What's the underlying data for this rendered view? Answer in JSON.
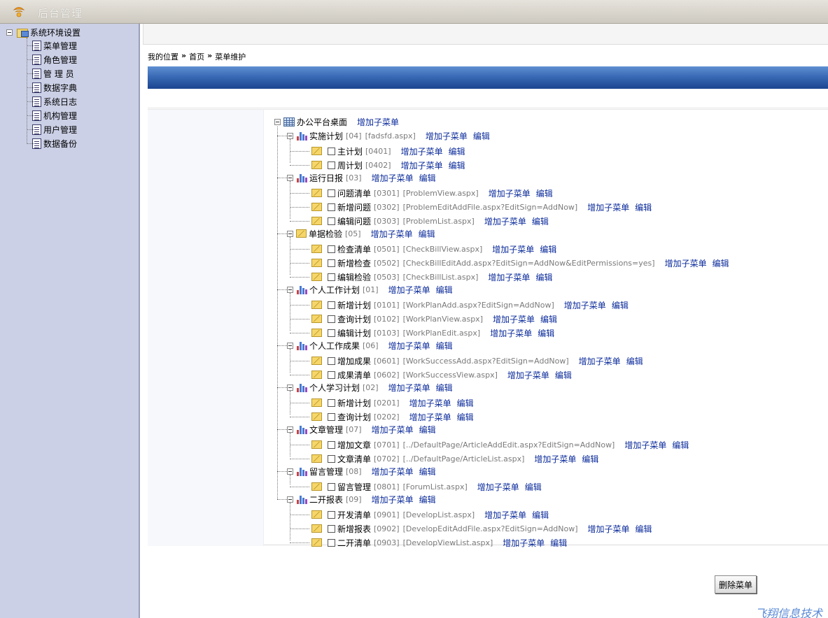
{
  "app": {
    "title": "后台管理"
  },
  "sidebar": {
    "root_label": "系统环境设置",
    "items": [
      {
        "label": "菜单管理"
      },
      {
        "label": "角色管理"
      },
      {
        "label": "管 理 员"
      },
      {
        "label": "数据字典"
      },
      {
        "label": "系统日志"
      },
      {
        "label": "机构管理"
      },
      {
        "label": "用户管理"
      },
      {
        "label": "数据备份"
      }
    ]
  },
  "breadcrumb": {
    "prefix": "我的位置",
    "sep": "»",
    "home": "首页",
    "current": "菜单维护"
  },
  "menu_tree": {
    "root": {
      "label": "办公平台桌面",
      "add": "增加子菜单"
    },
    "groups": [
      {
        "label": "实施计划",
        "code": "[04]",
        "url": "[fadsfd.aspx]",
        "add": "增加子菜单",
        "edit": "编辑",
        "icon": "bars-icon",
        "children": [
          {
            "label": "主计划",
            "code": "[0401]",
            "url": "",
            "add": "增加子菜单",
            "edit": "编辑"
          },
          {
            "label": "周计划",
            "code": "[0402]",
            "url": "",
            "add": "增加子菜单",
            "edit": "编辑"
          }
        ]
      },
      {
        "label": "运行日报",
        "code": "[03]",
        "url": "",
        "add": "增加子菜单",
        "edit": "编辑",
        "icon": "bars-icon",
        "children": [
          {
            "label": "问题清单",
            "code": "[0301]",
            "url": "[ProblemView.aspx]",
            "add": "增加子菜单",
            "edit": "编辑"
          },
          {
            "label": "新增问题",
            "code": "[0302]",
            "url": "[ProblemEditAddFile.aspx?EditSign=AddNow]",
            "add": "增加子菜单",
            "edit": "编辑"
          },
          {
            "label": "编辑问题",
            "code": "[0303]",
            "url": "[ProblemList.aspx]",
            "add": "增加子菜单",
            "edit": "编辑"
          }
        ]
      },
      {
        "label": "单据检验",
        "code": "[05]",
        "url": "",
        "add": "增加子菜单",
        "edit": "编辑",
        "icon": "envelope-icon",
        "children": [
          {
            "label": "检查清单",
            "code": "[0501]",
            "url": "[CheckBillView.aspx]",
            "add": "增加子菜单",
            "edit": "编辑"
          },
          {
            "label": "新增检查",
            "code": "[0502]",
            "url": "[CheckBillEditAdd.aspx?EditSign=AddNow&EditPermissions=yes]",
            "add": "增加子菜单",
            "edit": "编辑"
          },
          {
            "label": "编辑检验",
            "code": "[0503]",
            "url": "[CheckBillList.aspx]",
            "add": "增加子菜单",
            "edit": "编辑"
          }
        ]
      },
      {
        "label": "个人工作计划",
        "code": "[01]",
        "url": "",
        "add": "增加子菜单",
        "edit": "编辑",
        "icon": "bars-icon",
        "children": [
          {
            "label": "新增计划",
            "code": "[0101]",
            "url": "[WorkPlanAdd.aspx?EditSign=AddNow]",
            "add": "增加子菜单",
            "edit": "编辑"
          },
          {
            "label": "查询计划",
            "code": "[0102]",
            "url": "[WorkPlanView.aspx]",
            "add": "增加子菜单",
            "edit": "编辑"
          },
          {
            "label": "编辑计划",
            "code": "[0103]",
            "url": "[WorkPlanEdit.aspx]",
            "add": "增加子菜单",
            "edit": "编辑"
          }
        ]
      },
      {
        "label": "个人工作成果",
        "code": "[06]",
        "url": "",
        "add": "增加子菜单",
        "edit": "编辑",
        "icon": "bars-icon",
        "children": [
          {
            "label": "增加成果",
            "code": "[0601]",
            "url": "[WorkSuccessAdd.aspx?EditSign=AddNow]",
            "add": "增加子菜单",
            "edit": "编辑"
          },
          {
            "label": "成果清单",
            "code": "[0602]",
            "url": "[WorkSuccessView.aspx]",
            "add": "增加子菜单",
            "edit": "编辑"
          }
        ]
      },
      {
        "label": "个人学习计划",
        "code": "[02]",
        "url": "",
        "add": "增加子菜单",
        "edit": "编辑",
        "icon": "bars-icon",
        "children": [
          {
            "label": "新增计划",
            "code": "[0201]",
            "url": "",
            "add": "增加子菜单",
            "edit": "编辑"
          },
          {
            "label": "查询计划",
            "code": "[0202]",
            "url": "",
            "add": "增加子菜单",
            "edit": "编辑"
          }
        ]
      },
      {
        "label": "文章管理",
        "code": "[07]",
        "url": "",
        "add": "增加子菜单",
        "edit": "编辑",
        "icon": "bars-icon",
        "children": [
          {
            "label": "增加文章",
            "code": "[0701]",
            "url": "[../DefaultPage/ArticleAddEdit.aspx?EditSign=AddNow]",
            "add": "增加子菜单",
            "edit": "编辑"
          },
          {
            "label": "文章清单",
            "code": "[0702]",
            "url": "[../DefaultPage/ArticleList.aspx]",
            "add": "增加子菜单",
            "edit": "编辑"
          }
        ]
      },
      {
        "label": "留言管理",
        "code": "[08]",
        "url": "",
        "add": "增加子菜单",
        "edit": "编辑",
        "icon": "bars-icon",
        "children": [
          {
            "label": "留言管理",
            "code": "[0801]",
            "url": "[ForumList.aspx]",
            "add": "增加子菜单",
            "edit": "编辑"
          }
        ]
      },
      {
        "label": "二开报表",
        "code": "[09]",
        "url": "",
        "add": "增加子菜单",
        "edit": "编辑",
        "icon": "bars-icon",
        "children": [
          {
            "label": "开发清单",
            "code": "[0901]",
            "url": "[DevelopList.aspx]",
            "add": "增加子菜单",
            "edit": "编辑"
          },
          {
            "label": "新增报表",
            "code": "[0902]",
            "url": "[DevelopEditAddFile.aspx?EditSign=AddNow]",
            "add": "增加子菜单",
            "edit": "编辑"
          },
          {
            "label": "二开清单",
            "code": "[0903]",
            "url": "[DevelopViewList.aspx]",
            "add": "增加子菜单",
            "edit": "编辑"
          }
        ]
      }
    ]
  },
  "actions": {
    "delete_label": "删除菜单"
  },
  "footer": {
    "brand": "飞翔信息技术"
  }
}
